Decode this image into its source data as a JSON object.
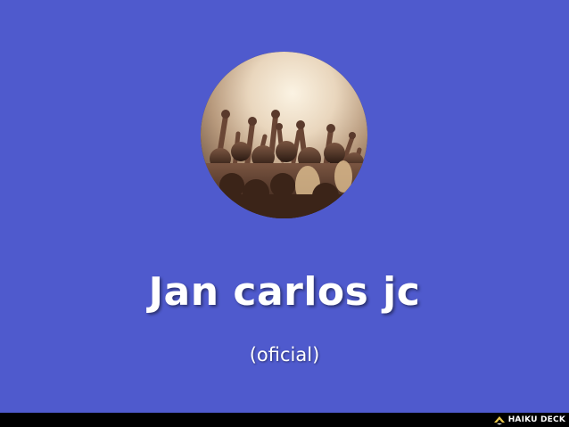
{
  "slide": {
    "title": "Jan carlos jc",
    "subtitle": "(oficial)",
    "background_color": "#4f5acd",
    "photo_icon": "concert-crowd-photo"
  },
  "footer": {
    "brand_label": "HAIKU DECK",
    "brand_icon": "haiku-deck-logo-icon"
  }
}
